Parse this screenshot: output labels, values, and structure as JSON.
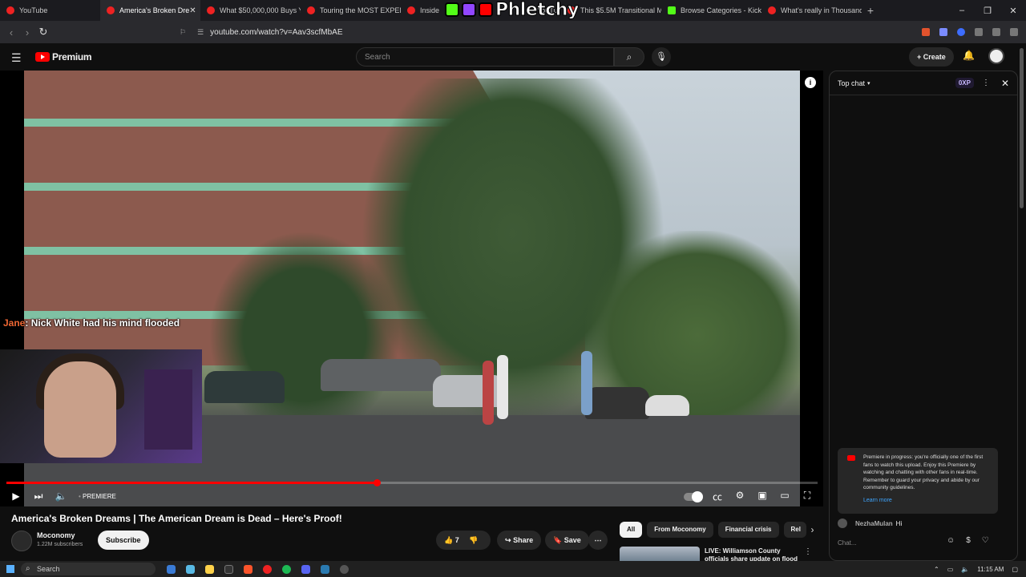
{
  "browser": {
    "tabs": [
      {
        "label": "YouTube",
        "active": false
      },
      {
        "label": "America's Broken Dre",
        "active": true
      },
      {
        "label": "What $50,000,000 Buys Yo",
        "active": false
      },
      {
        "label": "Touring the MOST EXPENS",
        "active": false
      },
      {
        "label": "Inside",
        "active": false
      },
      {
        "label": "YouTu",
        "active": false
      },
      {
        "label": "This $5.5M Transitional M",
        "active": false
      },
      {
        "label": "Browse Categories - Kick",
        "active": false
      },
      {
        "label": "What's really in Thousand",
        "active": false
      }
    ],
    "overlay_logo_text": "Phletchy",
    "url": "youtube.com/watch?v=Aav3scfMbAE"
  },
  "header": {
    "logo_text": "Premium",
    "search_placeholder": "Search",
    "create_label": "+ Create"
  },
  "player": {
    "chat_overlay_user": "Jane",
    "chat_overlay_text": ": Nick White had his mind flooded",
    "progress_fraction": 0.457,
    "buffer_fraction": 0.515,
    "live_label": "PREMIERE"
  },
  "video": {
    "title": "America's Broken Dreams | The American Dream is Dead – Here's Proof!",
    "channel": "Moconomy",
    "subscribers": "1.22M subscribers",
    "subscribe_label": "Subscribe",
    "likes": "7",
    "share_label": "Share",
    "save_label": "Save"
  },
  "recommendations": {
    "chips": [
      "All",
      "From Moconomy",
      "Financial crisis",
      "Rel"
    ],
    "first_title": "LIVE: Williamson County officials share update on flood"
  },
  "chat": {
    "header": "Top chat",
    "xp_badge": "0XP",
    "notice_text": "Premiere in progress: you're officially one of the first fans to watch this upload. Enjoy this Premiere by watching and chatting with other fans in real-time. Remember to guard your privacy and abide by our community guidelines.",
    "learn_more": "Learn more",
    "message_author": "NezhaMulan",
    "message_text": "Hi",
    "input_placeholder": "Chat..."
  },
  "taskbar": {
    "search_label": "Search",
    "clock": "11:15 AM"
  }
}
